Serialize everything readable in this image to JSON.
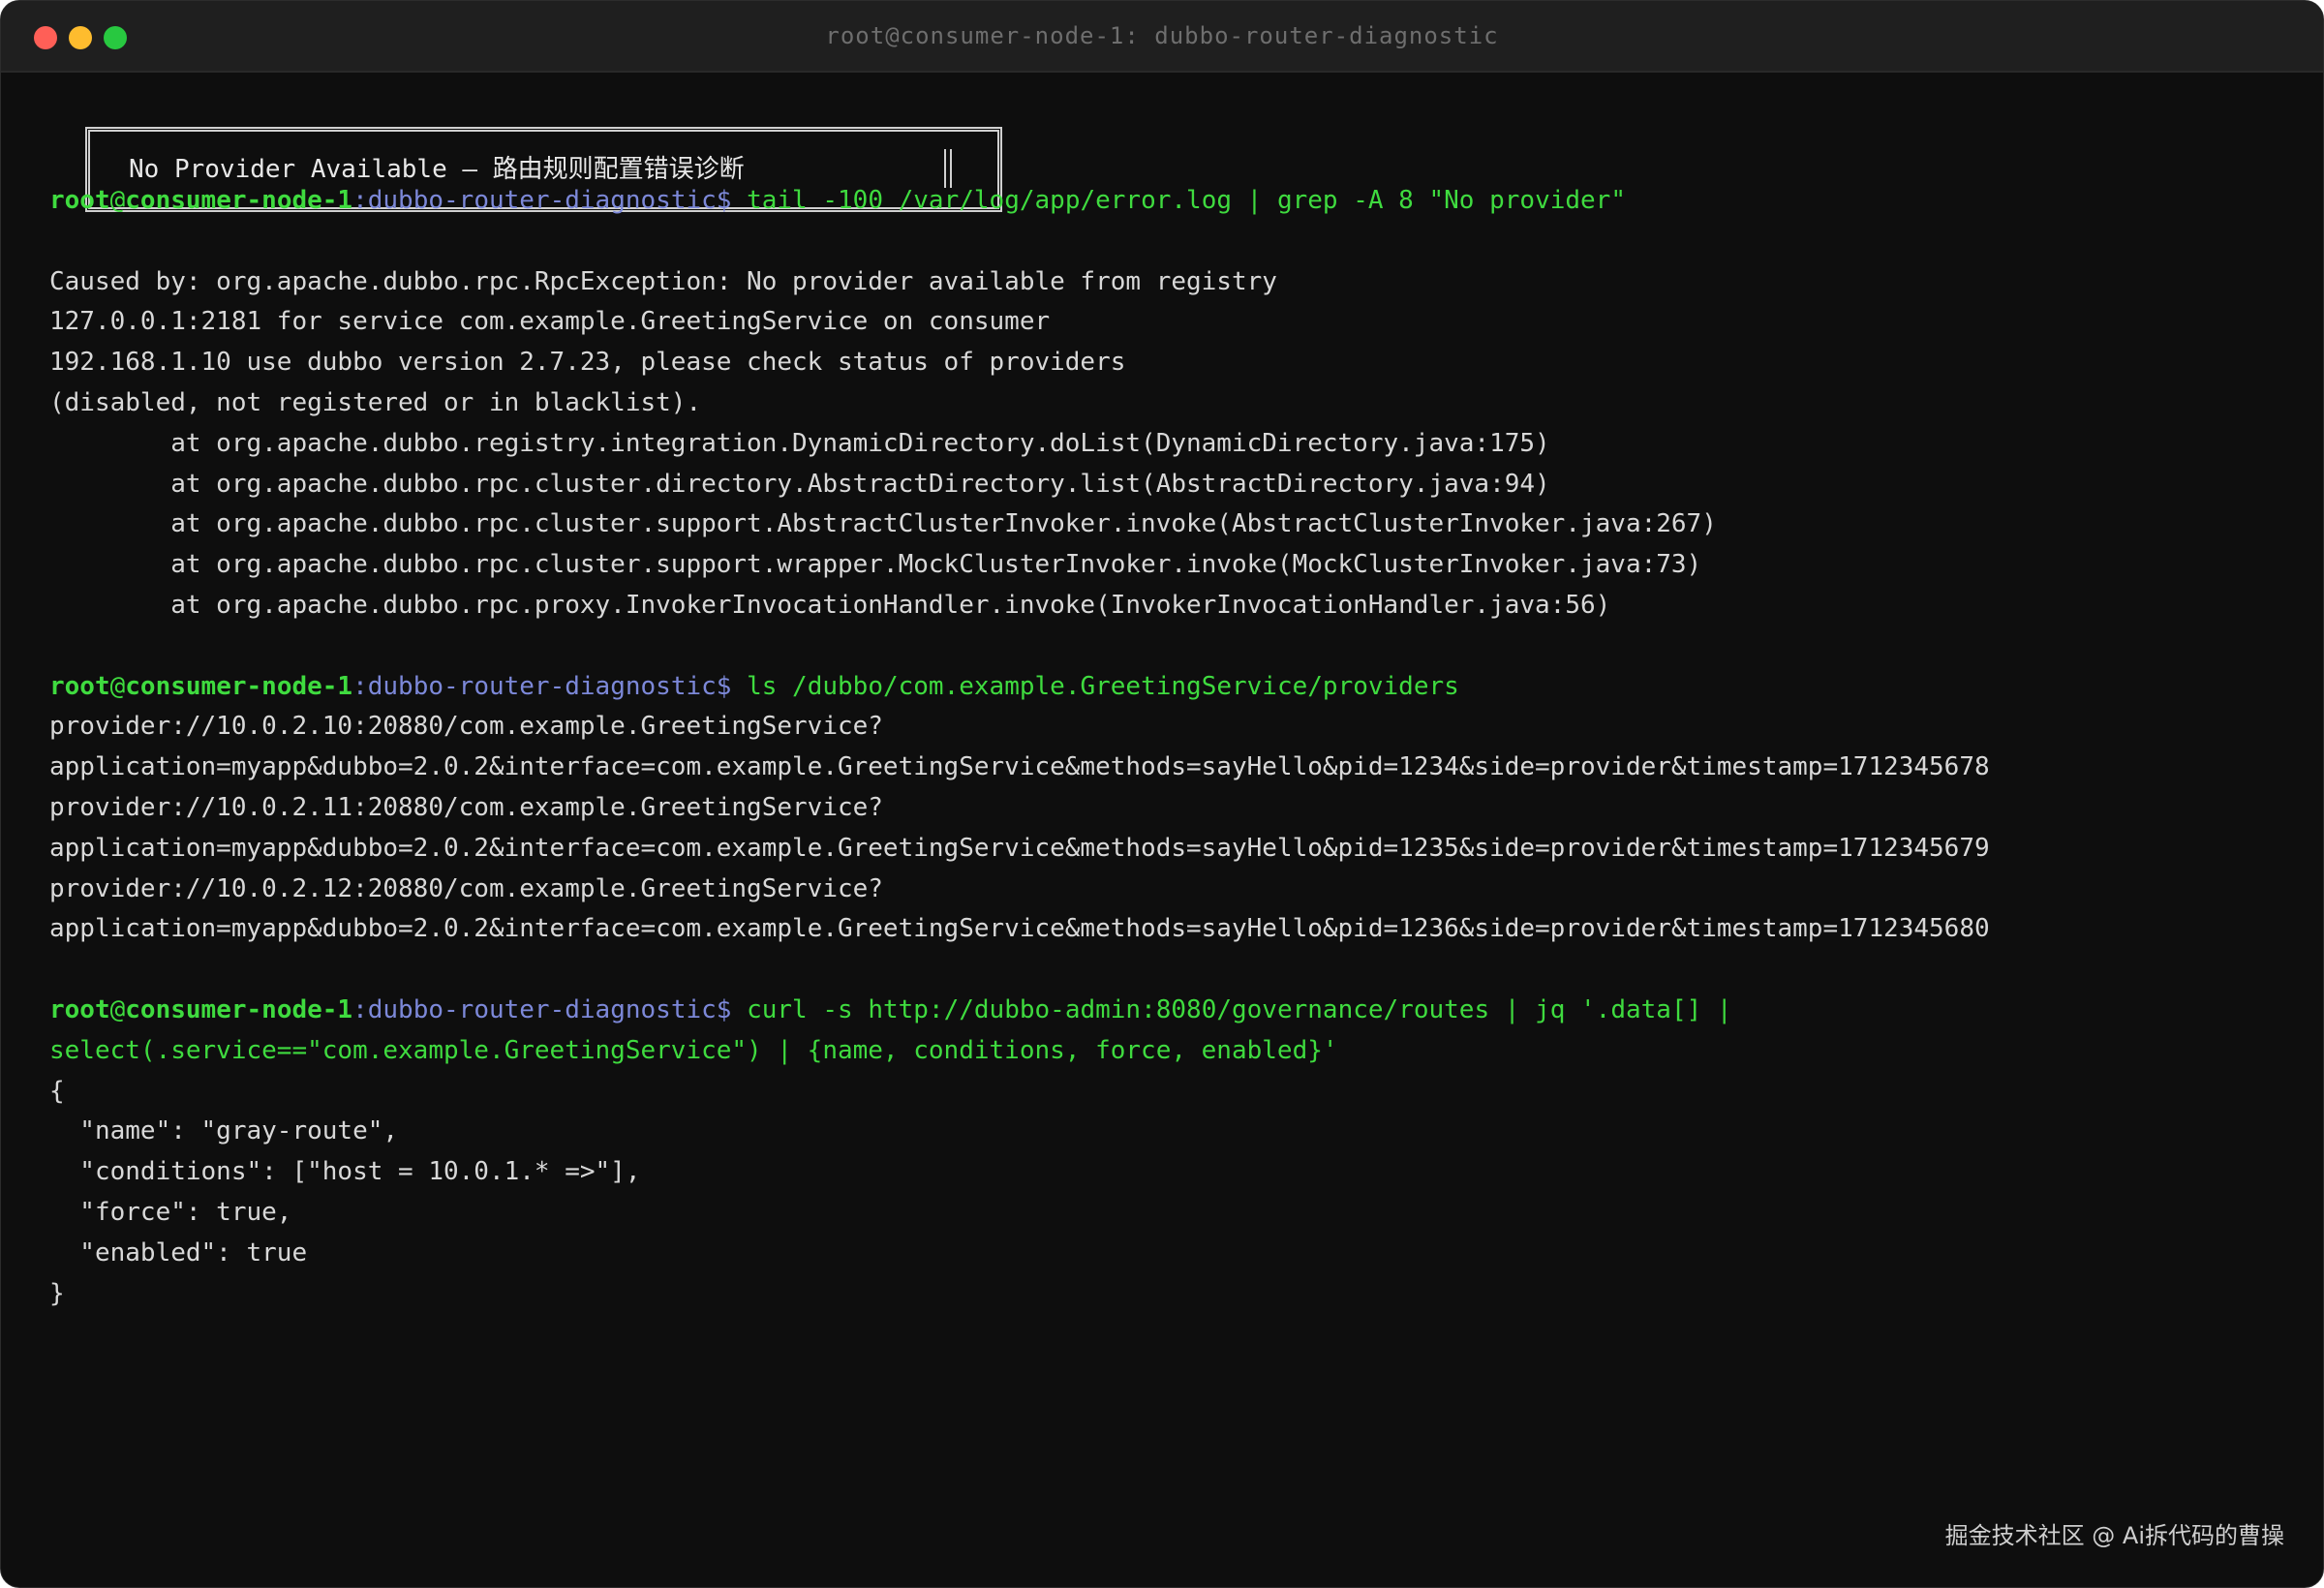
{
  "window": {
    "title": "root@consumer-node-1: dubbo-router-diagnostic",
    "colors": {
      "background": "#0e0e0e",
      "titlebar": "#1f1f1f",
      "prompt_green": "#3fdb3f",
      "prompt_blue": "#7c88d8",
      "text": "#d8d8d8",
      "close": "#ff5f57",
      "minimize": "#febc2e",
      "zoom": "#28c840"
    }
  },
  "banner": {
    "text": "No Provider Available — 路由规则配置错误诊断"
  },
  "prompt": {
    "user": "root",
    "at": "@",
    "host": "consumer-node-1",
    "colon": ":",
    "path": "dubbo-router-diagnostic",
    "dollar": "$"
  },
  "blocks": [
    {
      "command": [
        "tail -100 /var/log/app/error.log | grep -A 8 \"No provider\""
      ],
      "output": [
        "",
        "Caused by: org.apache.dubbo.rpc.RpcException: No provider available from registry",
        "127.0.0.1:2181 for service com.example.GreetingService on consumer",
        "192.168.1.10 use dubbo version 2.7.23, please check status of providers",
        "(disabled, not registered or in blacklist).",
        "        at org.apache.dubbo.registry.integration.DynamicDirectory.doList(DynamicDirectory.java:175)",
        "        at org.apache.dubbo.rpc.cluster.directory.AbstractDirectory.list(AbstractDirectory.java:94)",
        "        at org.apache.dubbo.rpc.cluster.support.AbstractClusterInvoker.invoke(AbstractClusterInvoker.java:267)",
        "        at org.apache.dubbo.rpc.cluster.support.wrapper.MockClusterInvoker.invoke(MockClusterInvoker.java:73)",
        "        at org.apache.dubbo.rpc.proxy.InvokerInvocationHandler.invoke(InvokerInvocationHandler.java:56)"
      ]
    },
    {
      "command": [
        "ls /dubbo/com.example.GreetingService/providers"
      ],
      "output": [
        "provider://10.0.2.10:20880/com.example.GreetingService?",
        "application=myapp&dubbo=2.0.2&interface=com.example.GreetingService&methods=sayHello&pid=1234&side=provider&timestamp=1712345678",
        "provider://10.0.2.11:20880/com.example.GreetingService?",
        "application=myapp&dubbo=2.0.2&interface=com.example.GreetingService&methods=sayHello&pid=1235&side=provider&timestamp=1712345679",
        "provider://10.0.2.12:20880/com.example.GreetingService?",
        "application=myapp&dubbo=2.0.2&interface=com.example.GreetingService&methods=sayHello&pid=1236&side=provider&timestamp=1712345680"
      ]
    },
    {
      "command": [
        "curl -s http://dubbo-admin:8080/governance/routes | jq '.data[] |",
        "select(.service==\"com.example.GreetingService\") | {name, conditions, force, enabled}'"
      ],
      "output": [
        "{",
        "  \"name\": \"gray-route\",",
        "  \"conditions\": [\"host = 10.0.1.* =>\"],",
        "  \"force\": true,",
        "  \"enabled\": true",
        "}"
      ]
    }
  ],
  "watermark": {
    "text": "掘金技术社区 @ Ai拆代码的曹操"
  }
}
